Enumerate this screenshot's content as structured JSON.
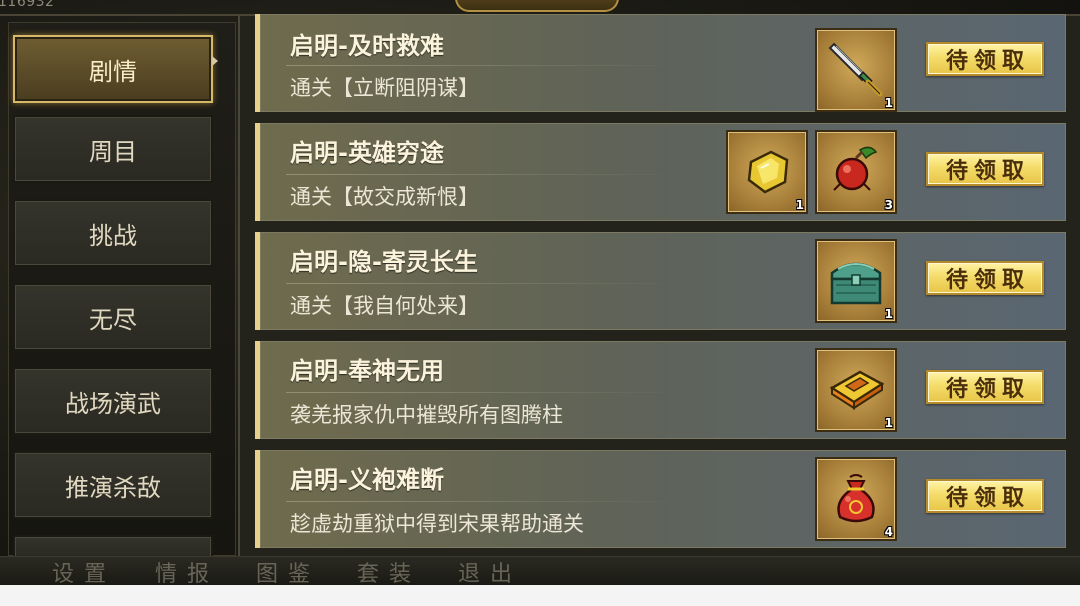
{
  "header": {
    "id_fragment": "116932"
  },
  "sidebar": {
    "items": [
      {
        "label": "剧情",
        "active": true
      },
      {
        "label": "周目",
        "active": false
      },
      {
        "label": "挑战",
        "active": false
      },
      {
        "label": "无尽",
        "active": false
      },
      {
        "label": "战场演武",
        "active": false
      },
      {
        "label": "推演杀敌",
        "active": false
      }
    ]
  },
  "quests": [
    {
      "title": "启明-及时救难",
      "desc": "通关【立断阻阴谋】",
      "button": "待领取",
      "rewards": [
        {
          "icon": "sword-icon",
          "count": "1"
        }
      ]
    },
    {
      "title": "启明-英雄穷途",
      "desc": "通关【故交成新恨】",
      "button": "待领取",
      "rewards": [
        {
          "icon": "gold-nugget-icon",
          "count": "1"
        },
        {
          "icon": "red-fruit-icon",
          "count": "3"
        }
      ]
    },
    {
      "title": "启明-隐-寄灵长生",
      "desc": "通关【我自何处来】",
      "button": "待领取",
      "rewards": [
        {
          "icon": "jade-chest-icon",
          "count": "1"
        }
      ]
    },
    {
      "title": "启明-奉神无用",
      "desc": "袭羌报家仇中摧毁所有图腾柱",
      "button": "待领取",
      "rewards": [
        {
          "icon": "skill-book-icon",
          "count": "1"
        }
      ]
    },
    {
      "title": "启明-义袍难断",
      "desc": "趁虚劫重狱中得到宋果帮助通关",
      "button": "待领取",
      "rewards": [
        {
          "icon": "money-bag-icon",
          "count": "4"
        }
      ]
    }
  ],
  "bottom_nav": [
    "设置",
    "情报",
    "图鉴",
    "套装",
    "退出"
  ],
  "colors": {
    "claim_button": "#f4dc6a",
    "accent_border": "#e6d08a",
    "active_tab": "#6f5d33"
  }
}
